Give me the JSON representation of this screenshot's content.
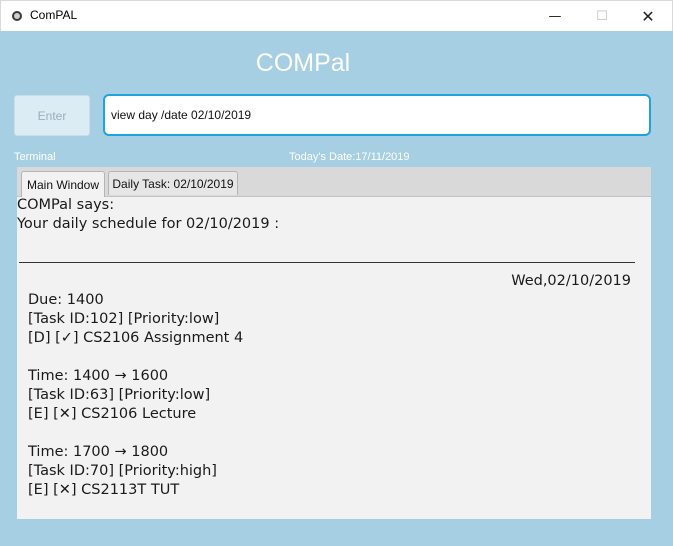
{
  "window": {
    "title": "ComPAL",
    "minimize_glyph": "—",
    "maximize_glyph": "☐",
    "close_glyph": "✕"
  },
  "app": {
    "heading": "COMPal"
  },
  "command_bar": {
    "enter_label": "Enter",
    "input_value": "view day /date 02/10/2019"
  },
  "status": {
    "terminal_label": "Terminal",
    "todays_date": "Today's Date:17/11/2019"
  },
  "tabs": [
    {
      "label": "Main Window",
      "selected": true
    },
    {
      "label": "Daily Task: 02/10/2019",
      "selected": false
    }
  ],
  "output": {
    "says": "COMPal says:",
    "schedule_header": "Your daily schedule for 02/10/2019 :",
    "day_label": "Wed,02/10/2019",
    "tasks": [
      {
        "line1": "Due: 1400",
        "line2": "[Task ID:102] [Priority:low]",
        "line3": "[D] [✓] CS2106 Assignment 4"
      },
      {
        "line1": "Time: 1400 → 1600",
        "line2": "[Task ID:63] [Priority:low]",
        "line3": "[E] [✕] CS2106 Lecture"
      },
      {
        "line1": "Time: 1700 → 1800",
        "line2": "[Task ID:70] [Priority:high]",
        "line3": "[E] [✕] CS2113T TUT"
      }
    ]
  }
}
